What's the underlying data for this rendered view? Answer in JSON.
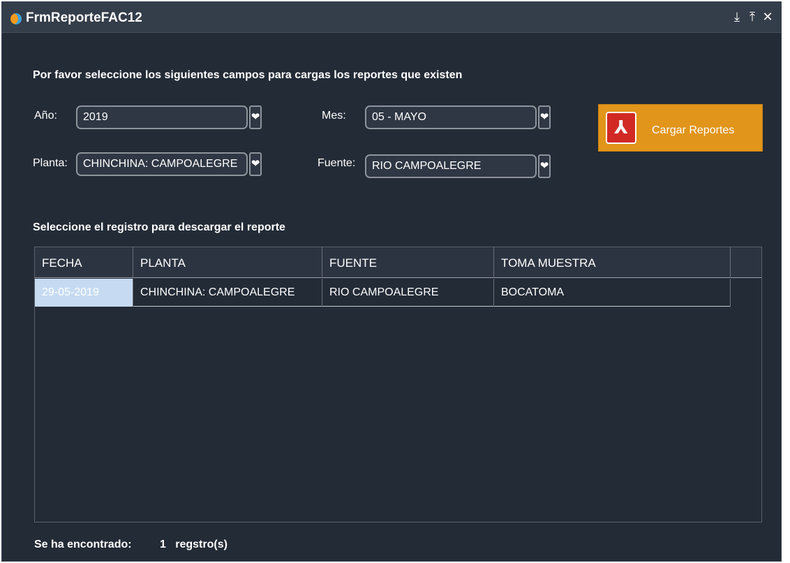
{
  "window": {
    "title": "FrmReporteFAC12",
    "controls": [
      {
        "name": "pin-icon",
        "glyph": "⤓"
      },
      {
        "name": "maximize-icon",
        "glyph": "⤒"
      },
      {
        "name": "close-icon",
        "glyph": "✕"
      }
    ]
  },
  "form": {
    "instructions": "Por favor seleccione los siguientes campos para cargas los reportes que existen",
    "year_label": "Año:",
    "year_value": "2019",
    "month_label": "Mes:",
    "month_value": "05 - MAYO",
    "plant_label": "Planta:",
    "plant_value": "CHINCHINA: CAMPOALEGRE",
    "source_label": "Fuente:",
    "source_value": "RIO CAMPOALEGRE",
    "dropdown_glyph": "❤",
    "load_button": "Cargar Reportes",
    "load_icon": "pdf-icon"
  },
  "grid": {
    "title": "Seleccione el registro para descargar el reporte",
    "columns": [
      "FECHA",
      "PLANTA",
      "FUENTE",
      "TOMA MUESTRA"
    ],
    "rows": [
      [
        "29-05-2019",
        "CHINCHINA: CAMPOALEGRE",
        "RIO CAMPOALEGRE",
        "BOCATOMA"
      ]
    ]
  },
  "footer": {
    "found_label": "Se ha encontrado:",
    "count_text": "1   regstro(s)"
  },
  "colors": {
    "background": "#232b36",
    "accent": "#e1951a",
    "selection": "#c6dbf1"
  }
}
